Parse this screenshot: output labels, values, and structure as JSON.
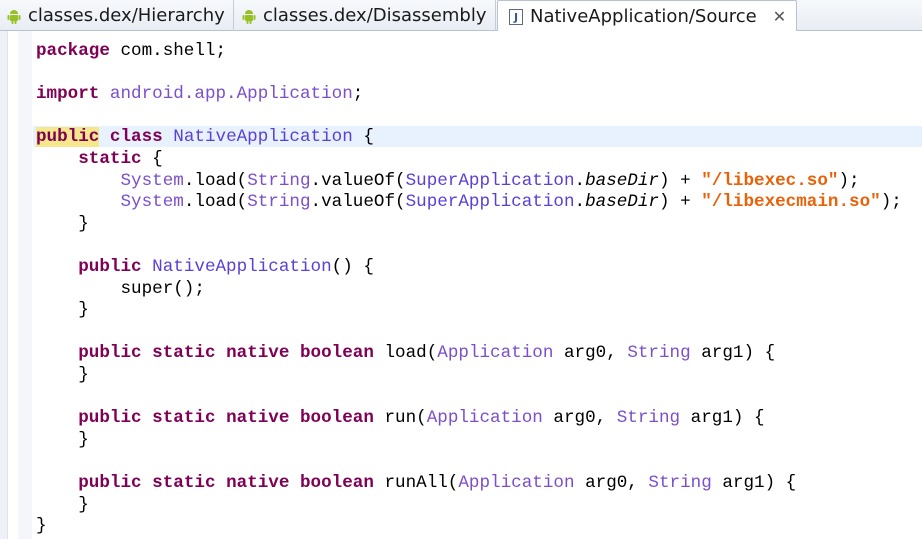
{
  "tabs": [
    {
      "label": "classes.dex/Hierarchy",
      "icon": "android-icon",
      "active": false
    },
    {
      "label": "classes.dex/Disassembly",
      "icon": "android-icon",
      "active": false
    },
    {
      "label": "NativeApplication/Source",
      "icon": "java-file-icon",
      "active": true,
      "close": "✕"
    }
  ],
  "code": {
    "lines": [
      [
        {
          "t": "package",
          "c": "kw"
        },
        {
          "t": " com.shell;",
          "c": ""
        }
      ],
      [],
      [
        {
          "t": "import",
          "c": "kw"
        },
        {
          "t": " ",
          "c": ""
        },
        {
          "t": "android.app.Application",
          "c": "typ"
        },
        {
          "t": ";",
          "c": ""
        }
      ],
      [],
      [
        {
          "t": "public",
          "c": "kw hl-word"
        },
        {
          "t": " ",
          "c": ""
        },
        {
          "t": "class",
          "c": "kw"
        },
        {
          "t": " ",
          "c": ""
        },
        {
          "t": "NativeApplication",
          "c": "cls"
        },
        {
          "t": " {",
          "c": ""
        }
      ],
      [
        {
          "t": "    ",
          "c": ""
        },
        {
          "t": "static",
          "c": "kw"
        },
        {
          "t": " {",
          "c": ""
        }
      ],
      [
        {
          "t": "        ",
          "c": ""
        },
        {
          "t": "System",
          "c": "typ"
        },
        {
          "t": ".load(",
          "c": ""
        },
        {
          "t": "String",
          "c": "typ"
        },
        {
          "t": ".valueOf(",
          "c": ""
        },
        {
          "t": "SuperApplication",
          "c": "cls"
        },
        {
          "t": ".",
          "c": ""
        },
        {
          "t": "baseDir",
          "c": "it"
        },
        {
          "t": ") + ",
          "c": ""
        },
        {
          "t": "\"/libexec.so\"",
          "c": "str"
        },
        {
          "t": ");",
          "c": ""
        }
      ],
      [
        {
          "t": "        ",
          "c": ""
        },
        {
          "t": "System",
          "c": "typ"
        },
        {
          "t": ".load(",
          "c": ""
        },
        {
          "t": "String",
          "c": "typ"
        },
        {
          "t": ".valueOf(",
          "c": ""
        },
        {
          "t": "SuperApplication",
          "c": "cls"
        },
        {
          "t": ".",
          "c": ""
        },
        {
          "t": "baseDir",
          "c": "it"
        },
        {
          "t": ") + ",
          "c": ""
        },
        {
          "t": "\"/libexecmain.so\"",
          "c": "str"
        },
        {
          "t": ");",
          "c": ""
        }
      ],
      [
        {
          "t": "    }",
          "c": ""
        }
      ],
      [],
      [
        {
          "t": "    ",
          "c": ""
        },
        {
          "t": "public",
          "c": "kw"
        },
        {
          "t": " ",
          "c": ""
        },
        {
          "t": "NativeApplication",
          "c": "cls"
        },
        {
          "t": "() {",
          "c": ""
        }
      ],
      [
        {
          "t": "        super();",
          "c": ""
        }
      ],
      [
        {
          "t": "    }",
          "c": ""
        }
      ],
      [],
      [
        {
          "t": "    ",
          "c": ""
        },
        {
          "t": "public",
          "c": "kw"
        },
        {
          "t": " ",
          "c": ""
        },
        {
          "t": "static",
          "c": "kw"
        },
        {
          "t": " ",
          "c": ""
        },
        {
          "t": "native",
          "c": "kw"
        },
        {
          "t": " ",
          "c": ""
        },
        {
          "t": "boolean",
          "c": "kw"
        },
        {
          "t": " load(",
          "c": ""
        },
        {
          "t": "Application",
          "c": "typ"
        },
        {
          "t": " arg0, ",
          "c": ""
        },
        {
          "t": "String",
          "c": "typ"
        },
        {
          "t": " arg1) {",
          "c": ""
        }
      ],
      [
        {
          "t": "    }",
          "c": ""
        }
      ],
      [],
      [
        {
          "t": "    ",
          "c": ""
        },
        {
          "t": "public",
          "c": "kw"
        },
        {
          "t": " ",
          "c": ""
        },
        {
          "t": "static",
          "c": "kw"
        },
        {
          "t": " ",
          "c": ""
        },
        {
          "t": "native",
          "c": "kw"
        },
        {
          "t": " ",
          "c": ""
        },
        {
          "t": "boolean",
          "c": "kw"
        },
        {
          "t": " run(",
          "c": ""
        },
        {
          "t": "Application",
          "c": "typ"
        },
        {
          "t": " arg0, ",
          "c": ""
        },
        {
          "t": "String",
          "c": "typ"
        },
        {
          "t": " arg1) {",
          "c": ""
        }
      ],
      [
        {
          "t": "    }",
          "c": ""
        }
      ],
      [],
      [
        {
          "t": "    ",
          "c": ""
        },
        {
          "t": "public",
          "c": "kw"
        },
        {
          "t": " ",
          "c": ""
        },
        {
          "t": "static",
          "c": "kw"
        },
        {
          "t": " ",
          "c": ""
        },
        {
          "t": "native",
          "c": "kw"
        },
        {
          "t": " ",
          "c": ""
        },
        {
          "t": "boolean",
          "c": "kw"
        },
        {
          "t": " runAll(",
          "c": ""
        },
        {
          "t": "Application",
          "c": "typ"
        },
        {
          "t": " arg0, ",
          "c": ""
        },
        {
          "t": "String",
          "c": "typ"
        },
        {
          "t": " arg1) {",
          "c": ""
        }
      ],
      [
        {
          "t": "    }",
          "c": ""
        }
      ],
      [
        {
          "t": "}",
          "c": ""
        }
      ]
    ]
  },
  "colors": {
    "keyword": "#7f0055",
    "type": "#7b4fc9",
    "string": "#e8620a",
    "current_line": "#e8f2fe",
    "occurrence_highlight": "#f5e88c"
  }
}
